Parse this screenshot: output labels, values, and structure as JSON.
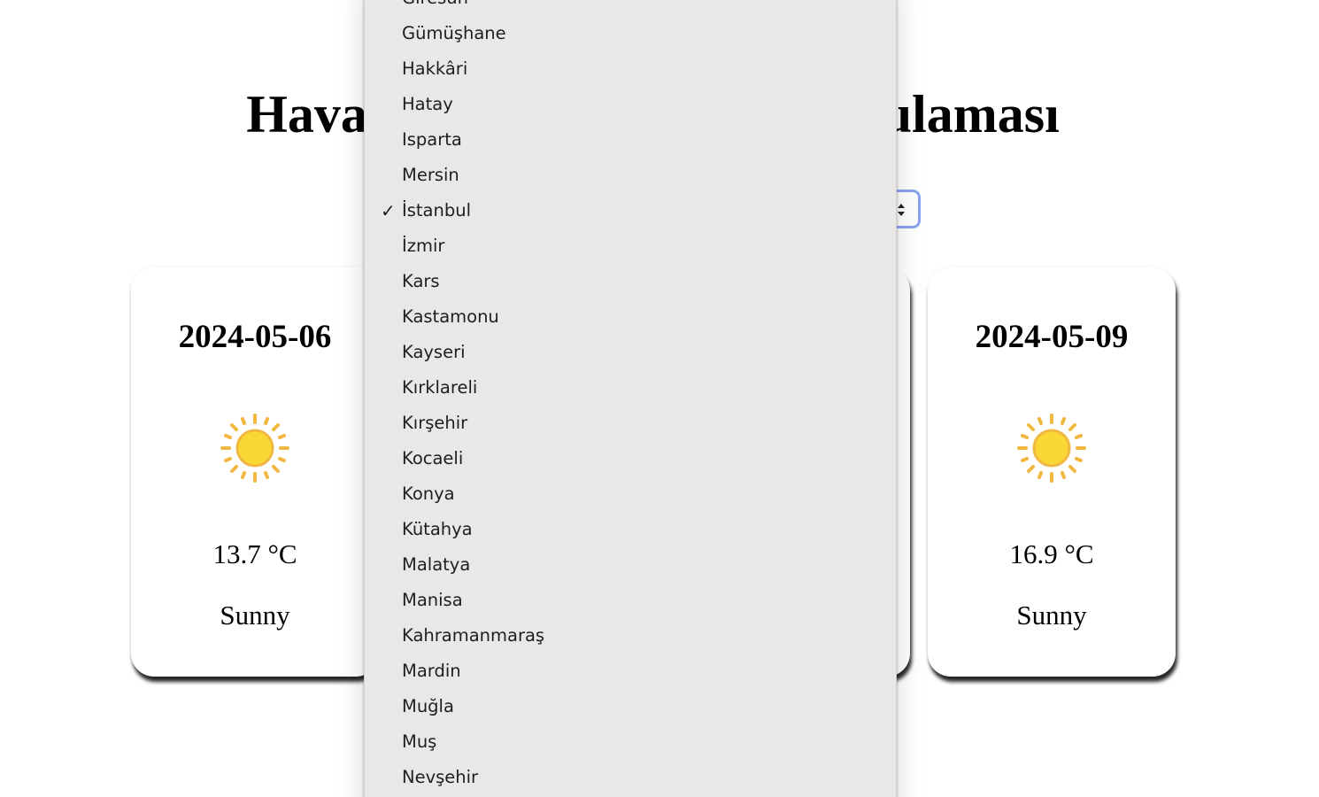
{
  "page": {
    "title": "Hava Durumu Tahmini Uygulaması"
  },
  "city_select": {
    "selected": "İstanbul",
    "options": [
      {
        "label": "Giresun"
      },
      {
        "label": "Gümüşhane"
      },
      {
        "label": "Hakkâri"
      },
      {
        "label": "Hatay"
      },
      {
        "label": "Isparta"
      },
      {
        "label": "Mersin"
      },
      {
        "label": "İstanbul"
      },
      {
        "label": "İzmir"
      },
      {
        "label": "Kars"
      },
      {
        "label": "Kastamonu"
      },
      {
        "label": "Kayseri"
      },
      {
        "label": "Kırklareli"
      },
      {
        "label": "Kırşehir"
      },
      {
        "label": "Kocaeli"
      },
      {
        "label": "Konya"
      },
      {
        "label": "Kütahya"
      },
      {
        "label": "Malatya"
      },
      {
        "label": "Manisa"
      },
      {
        "label": "Kahramanmaraş"
      },
      {
        "label": "Mardin"
      },
      {
        "label": "Muğla"
      },
      {
        "label": "Muş"
      },
      {
        "label": "Nevşehir"
      }
    ],
    "check_mark": "✓"
  },
  "forecast": {
    "cards": [
      {
        "date": "2024-05-06",
        "icon": "sun-icon",
        "temperature": "13.7 °C",
        "condition": "Sunny"
      },
      {
        "date": "2024-05-09",
        "icon": "sun-icon",
        "temperature": "16.9 °C",
        "condition": "Sunny"
      }
    ]
  },
  "colors": {
    "select_focus_ring": "#8aa4ef",
    "dropdown_background": "#e9e8e6",
    "sun_core": "#f9d835",
    "sun_rays": "#f0b840"
  }
}
